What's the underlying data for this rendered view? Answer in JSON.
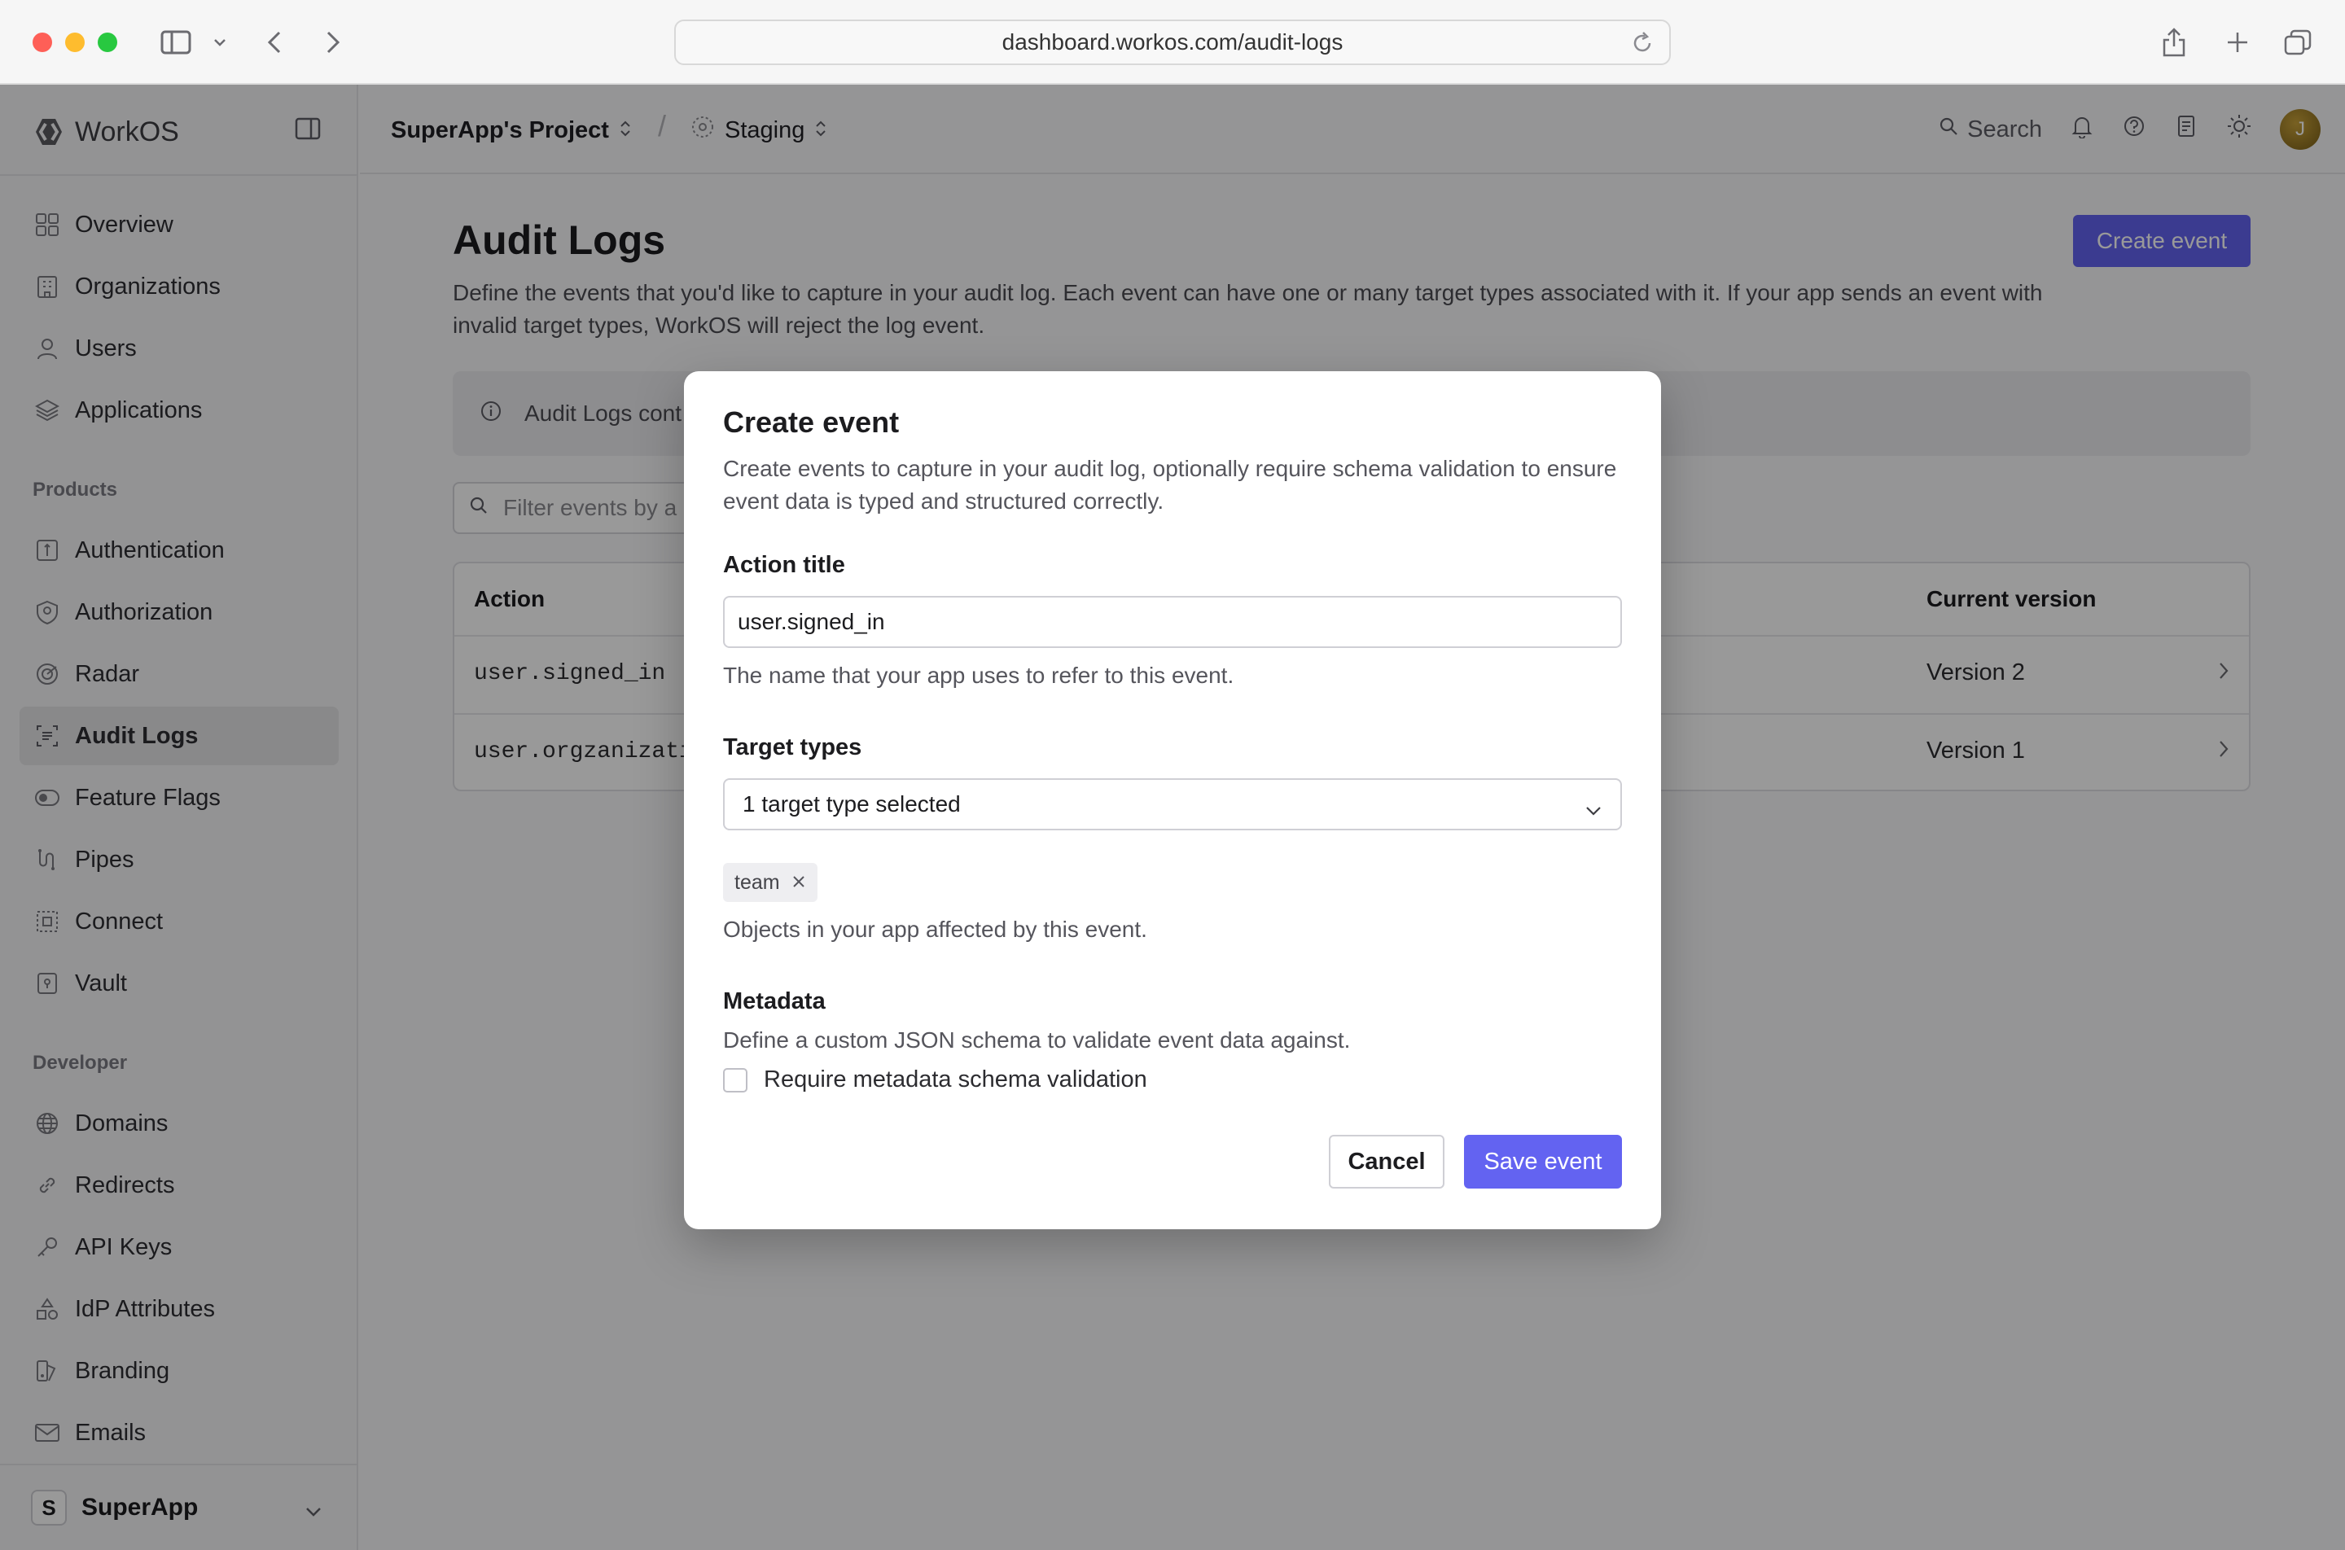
{
  "browser": {
    "url": "dashboard.workos.com/audit-logs"
  },
  "sidebar": {
    "brand": "WorkOS",
    "items": [
      {
        "label": "Overview"
      },
      {
        "label": "Organizations"
      },
      {
        "label": "Users"
      },
      {
        "label": "Applications"
      }
    ],
    "products_label": "Products",
    "products": [
      {
        "label": "Authentication"
      },
      {
        "label": "Authorization"
      },
      {
        "label": "Radar"
      },
      {
        "label": "Audit Logs",
        "active": true
      },
      {
        "label": "Feature Flags"
      },
      {
        "label": "Pipes"
      },
      {
        "label": "Connect"
      },
      {
        "label": "Vault"
      }
    ],
    "developer_label": "Developer",
    "developer": [
      {
        "label": "Domains"
      },
      {
        "label": "Redirects"
      },
      {
        "label": "API Keys"
      },
      {
        "label": "IdP Attributes"
      },
      {
        "label": "Branding"
      },
      {
        "label": "Emails"
      }
    ],
    "org": {
      "initial": "S",
      "name": "SuperApp"
    }
  },
  "topbar": {
    "project": "SuperApp's Project",
    "separator": "/",
    "environment": "Staging",
    "search_label": "Search",
    "avatar_initial": "J"
  },
  "page": {
    "title": "Audit Logs",
    "description": "Define the events that you'd like to capture in your audit log. Each event can have one or many target types associated with it. If your app sends an event with invalid target types, WorkOS will reject the log event.",
    "create_button": "Create event",
    "notice": "Audit Logs cont",
    "filter_placeholder": "Filter events by a",
    "table": {
      "columns": [
        "Action",
        "Current version"
      ],
      "rows": [
        {
          "action": "user.signed_in",
          "version": "Version 2"
        },
        {
          "action": "user.orgzanizatio",
          "version": "Version 1"
        }
      ]
    }
  },
  "modal": {
    "title": "Create event",
    "description": "Create events to capture in your audit log, optionally require schema validation to ensure event data is typed and structured correctly.",
    "action_title_label": "Action title",
    "action_title_value": "user.signed_in",
    "action_title_help": "The name that your app uses to refer to this event.",
    "target_types_label": "Target types",
    "target_types_selected": "1 target type selected",
    "target_chip": "team",
    "target_types_help": "Objects in your app affected by this event.",
    "metadata_label": "Metadata",
    "metadata_help": "Define a custom JSON schema to validate event data against.",
    "checkbox_label": "Require metadata schema validation",
    "checkbox_checked": false,
    "cancel_label": "Cancel",
    "save_label": "Save event"
  },
  "colors": {
    "accent": "#6363f1",
    "overlay": "rgba(0,0,0,0.40)"
  }
}
